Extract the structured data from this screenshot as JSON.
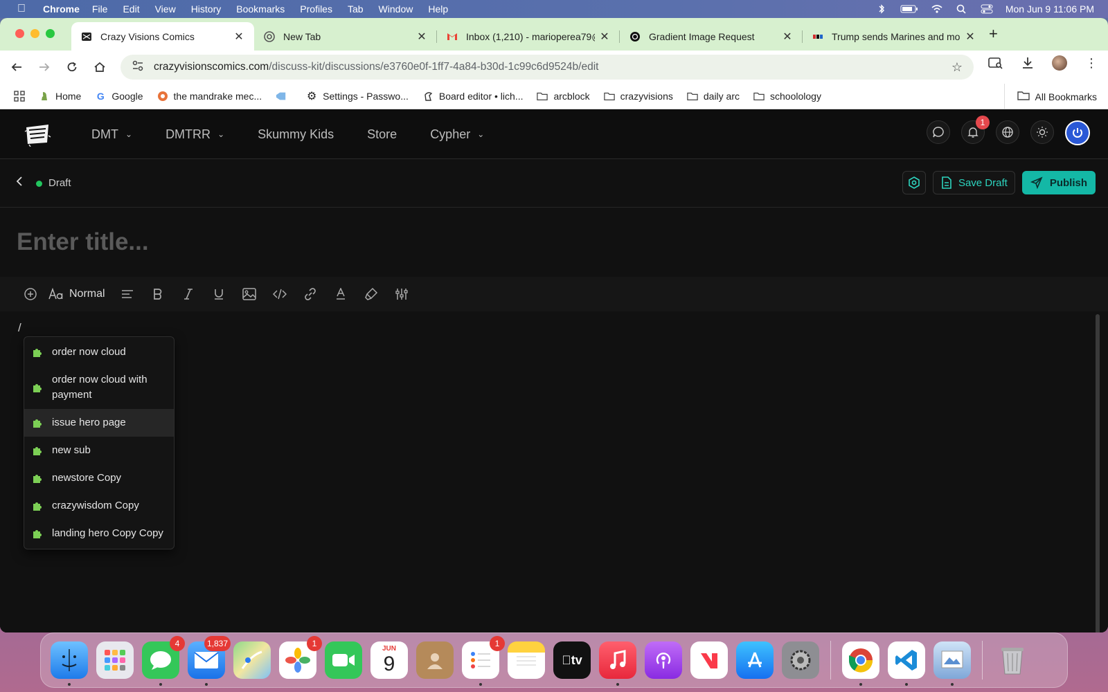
{
  "menubar": {
    "app_name": "Chrome",
    "items": [
      "File",
      "Edit",
      "View",
      "History",
      "Bookmarks",
      "Profiles",
      "Tab",
      "Window",
      "Help"
    ],
    "clock": "Mon Jun 9  11:06 PM"
  },
  "tabs": [
    {
      "title": "Crazy Visions Comics",
      "active": true
    },
    {
      "title": "New Tab",
      "active": false
    },
    {
      "title": "Inbox (1,210) - marioperea79@",
      "active": false
    },
    {
      "title": "Gradient Image Request",
      "active": false
    },
    {
      "title": "Trump sends Marines and mo",
      "active": false
    }
  ],
  "omnibox": {
    "host": "crazyvisionscomics.com",
    "path": "/discuss-kit/discussions/e3760e0f-1ff7-4a84-b30d-1c99c6d9524b/edit"
  },
  "bookmarks": [
    {
      "label": "Home",
      "icon": "chess-icon"
    },
    {
      "label": "Google",
      "icon": "google-icon"
    },
    {
      "label": "the mandrake mec...",
      "icon": "site-icon"
    },
    {
      "label": "",
      "icon": "tag-icon"
    },
    {
      "label": "Settings - Passwo...",
      "icon": "gear-icon"
    },
    {
      "label": "Board editor • lich...",
      "icon": "lichess-icon"
    },
    {
      "label": "arcblock",
      "icon": "folder-icon"
    },
    {
      "label": "crazyvisions",
      "icon": "folder-icon"
    },
    {
      "label": "daily arc",
      "icon": "folder-icon"
    },
    {
      "label": "schoolology",
      "icon": "folder-icon"
    }
  ],
  "all_bookmarks": "All Bookmarks",
  "site_nav": [
    {
      "label": "DMT",
      "dropdown": true
    },
    {
      "label": "DMTRR",
      "dropdown": true
    },
    {
      "label": "Skummy Kids",
      "dropdown": false
    },
    {
      "label": "Store",
      "dropdown": false
    },
    {
      "label": "Cypher",
      "dropdown": true
    }
  ],
  "notification_count": "1",
  "status": "Draft",
  "save_draft_label": "Save Draft",
  "publish_label": "Publish",
  "title_placeholder": "Enter title...",
  "text_style": "Normal",
  "slash_char": "/",
  "suggestions": [
    {
      "label": "order now cloud",
      "tall": false,
      "highlighted": false
    },
    {
      "label": "order now cloud with payment",
      "tall": true,
      "highlighted": false
    },
    {
      "label": "issue hero page",
      "tall": false,
      "highlighted": true
    },
    {
      "label": "new sub",
      "tall": false,
      "highlighted": false
    },
    {
      "label": "newstore Copy",
      "tall": false,
      "highlighted": false
    },
    {
      "label": "crazywisdom Copy",
      "tall": false,
      "highlighted": false
    },
    {
      "label": "landing hero Copy Copy",
      "tall": false,
      "highlighted": false
    }
  ],
  "dock": {
    "messages_badge": "4",
    "mail_badge": "1,837",
    "photos_badge": "1",
    "reminders_badge": "1",
    "calendar_month": "JUN",
    "calendar_day": "9"
  },
  "colors": {
    "accent": "#14b8a6",
    "status_dot": "#22c55e",
    "badge": "#e5484d",
    "tabstrip": "#d7f0cf"
  }
}
